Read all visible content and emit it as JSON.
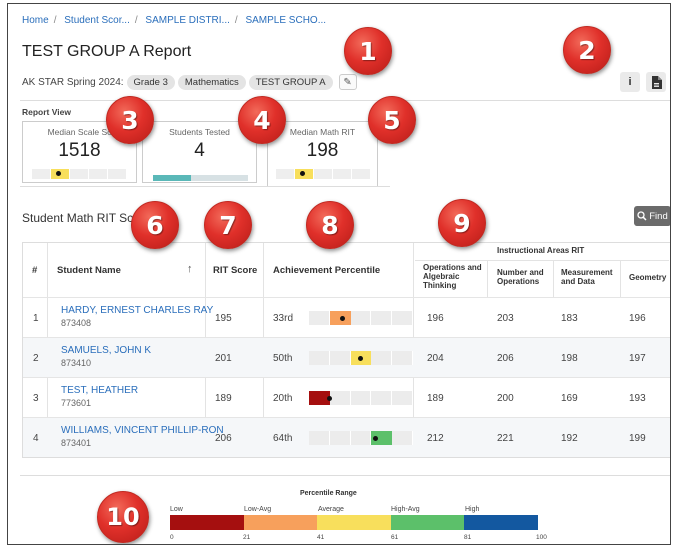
{
  "breadcrumb": [
    "Home",
    "Student Scor...",
    "SAMPLE DISTRI...",
    "SAMPLE SCHO..."
  ],
  "page_title": "TEST GROUP A Report",
  "meta": {
    "assessment": "AK STAR Spring 2024:",
    "pills": [
      "Grade 3",
      "Mathematics",
      "TEST GROUP A"
    ]
  },
  "report_view": {
    "label": "Report View",
    "cards": [
      {
        "label": "Median Scale Sc",
        "value": "1518"
      },
      {
        "label": "Students Tested",
        "value": "4",
        "progress": 0.4
      },
      {
        "label": "Median Math RIT",
        "value": "198"
      }
    ]
  },
  "section_title": "Student Math RIT Sc",
  "find_label": "Find",
  "table": {
    "group_header": "Instructional Areas RIT",
    "headers": {
      "num": "#",
      "name": "Student Name",
      "rit": "RIT Score",
      "percentile": "Achievement Percentile",
      "oat": "Operations and Algebraic Thinking",
      "nop": "Number and Operations",
      "md": "Measurement and Data",
      "geo": "Geometry"
    },
    "rows": [
      {
        "num": "1",
        "name": "HARDY, ERNEST CHARLES RAY",
        "id": "873408",
        "rit": "195",
        "pct": "33rd",
        "pct_value": 33,
        "oat": "196",
        "nop": "203",
        "md": "183",
        "geo": "196"
      },
      {
        "num": "2",
        "name": "SAMUELS, JOHN K",
        "id": "873410",
        "rit": "201",
        "pct": "50th",
        "pct_value": 50,
        "oat": "204",
        "nop": "206",
        "md": "198",
        "geo": "197"
      },
      {
        "num": "3",
        "name": "TEST, HEATHER",
        "id": "773601",
        "rit": "189",
        "pct": "20th",
        "pct_value": 20,
        "oat": "189",
        "nop": "200",
        "md": "169",
        "geo": "193"
      },
      {
        "num": "4",
        "name": "WILLIAMS, VINCENT PHILLIP-RON",
        "id": "873401",
        "rit": "206",
        "pct": "64th",
        "pct_value": 64,
        "oat": "212",
        "nop": "221",
        "md": "192",
        "geo": "199"
      }
    ]
  },
  "legend": {
    "title": "Percentile Range",
    "bands": [
      {
        "label": "Low",
        "color": "#a50f0f"
      },
      {
        "label": "Low-Avg",
        "color": "#f7a05c"
      },
      {
        "label": "Average",
        "color": "#f8df5c"
      },
      {
        "label": "High-Avg",
        "color": "#5cc06a"
      },
      {
        "label": "High",
        "color": "#1358a0"
      }
    ],
    "ticks": [
      "0",
      "21",
      "41",
      "61",
      "81",
      "100"
    ]
  },
  "callouts": [
    "1",
    "2",
    "3",
    "4",
    "5",
    "6",
    "7",
    "8",
    "9",
    "10"
  ],
  "icons": {
    "info": "info-icon",
    "pdf": "pdf-icon",
    "pencil": "pencil-icon",
    "search": "search-icon",
    "sort": "sort-arrow-icon"
  }
}
